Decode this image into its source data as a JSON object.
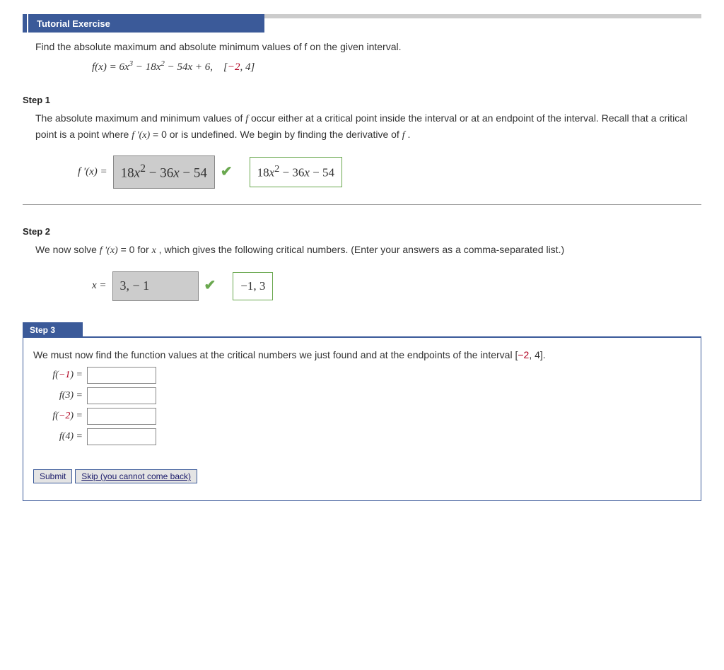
{
  "header": {
    "title": "Tutorial Exercise"
  },
  "prompt": {
    "text": "Find the absolute maximum and absolute minimum values of f on the given interval.",
    "formula_prefix": "f(x) = 6x",
    "formula_mid1": " − 18x",
    "formula_mid2": " − 54x + 6,",
    "interval_open": "    [",
    "interval_neg": "−2",
    "interval_rest": ", 4]"
  },
  "step1": {
    "label": "Step 1",
    "body_1": "The absolute maximum and minimum values of ",
    "body_f": "f",
    "body_2": " occur either at a critical point inside the interval or at an endpoint of the interval. Recall that a critical point is a point where ",
    "body_fprime": "f '(x)",
    "body_3": " = 0 or is undefined. We begin by finding the derivative of ",
    "body_f2": "f",
    "body_4": ".",
    "lhs": "f '(x) = ",
    "student_answer": "18x² − 36x − 54",
    "correct_answer": "18x² − 36x − 54",
    "check": "✔"
  },
  "step2": {
    "label": "Step 2",
    "body_1": "We now solve  ",
    "body_fprime": "f '(x)",
    "body_2": " = 0  for ",
    "body_x": "x",
    "body_3": ", which gives the following critical numbers. (Enter your answers as a comma-separated list.)",
    "lhs": "x = ",
    "student_answer": "3, − 1",
    "correct_answer": "−1, 3",
    "check": "✔"
  },
  "step3": {
    "label": "Step 3",
    "body_1": "We must now find the function values at the critical numbers we just found and at the endpoints of the interval  [",
    "interval_neg": "−2",
    "interval_rest": ", 4].",
    "rows": [
      {
        "label_pre": "f(",
        "label_arg": "−1",
        "label_post": ")  =",
        "neg": true
      },
      {
        "label_pre": "f(",
        "label_arg": "3",
        "label_post": ")  =",
        "neg": false
      },
      {
        "label_pre": "f(",
        "label_arg": "−2",
        "label_post": ")  =",
        "neg": true
      },
      {
        "label_pre": "f(",
        "label_arg": "4",
        "label_post": ")  =",
        "neg": false
      }
    ]
  },
  "buttons": {
    "submit": "Submit",
    "skip": "Skip (you cannot come back)"
  }
}
